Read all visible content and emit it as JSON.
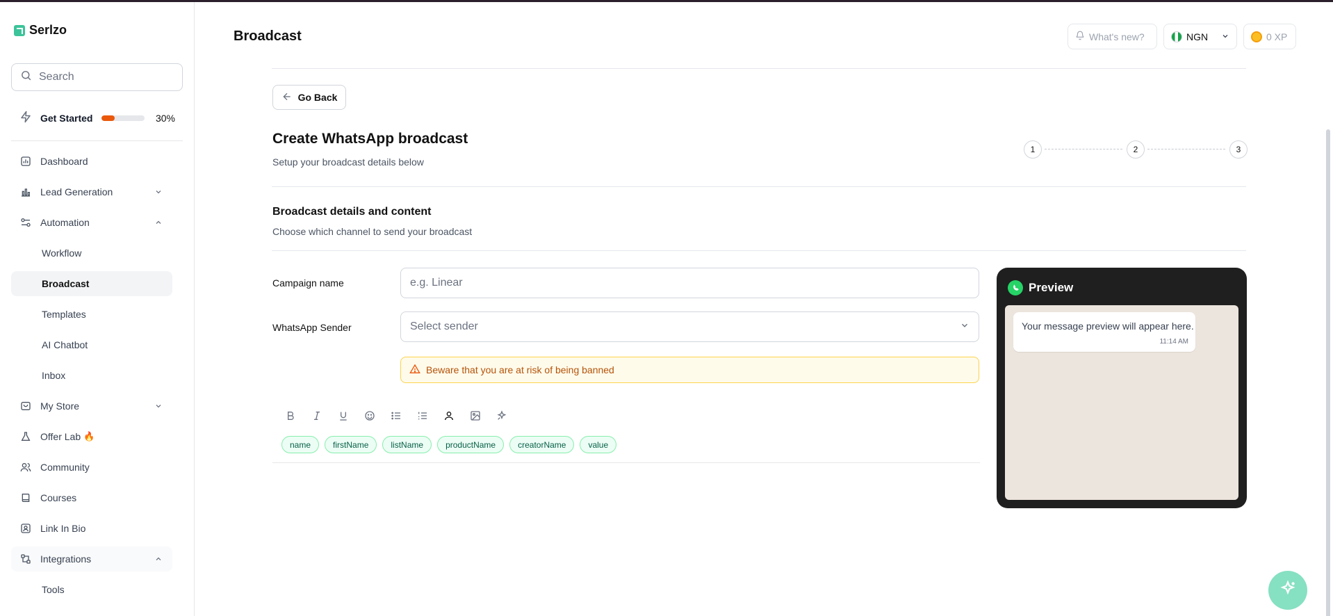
{
  "app": {
    "name": "Serlzo"
  },
  "sidebar": {
    "search_placeholder": "Search",
    "get_started": {
      "label": "Get Started",
      "progress_percent": 30,
      "progress_text": "30%"
    },
    "items": [
      {
        "label": "Dashboard",
        "icon": "chart-icon"
      },
      {
        "label": "Lead Generation",
        "icon": "chart-bar-icon",
        "expanded": false
      },
      {
        "label": "Automation",
        "icon": "automation-icon",
        "expanded": true
      },
      {
        "label": "Workflow",
        "sub": true
      },
      {
        "label": "Broadcast",
        "sub": true,
        "active": true
      },
      {
        "label": "Templates",
        "sub": true
      },
      {
        "label": "AI Chatbot",
        "sub": true
      },
      {
        "label": "Inbox",
        "sub": true
      },
      {
        "label": "My Store",
        "icon": "store-icon",
        "expanded": false
      },
      {
        "label": "Offer Lab",
        "icon": "flask-icon",
        "badge": "🔥"
      },
      {
        "label": "Community",
        "icon": "users-icon"
      },
      {
        "label": "Courses",
        "icon": "book-icon"
      },
      {
        "label": "Link In Bio",
        "icon": "profile-card-icon"
      },
      {
        "label": "Integrations",
        "icon": "integrations-icon",
        "expanded": true
      },
      {
        "label": "Tools",
        "sub": true
      }
    ]
  },
  "header": {
    "title": "Broadcast",
    "whats_new": "What's new?",
    "currency": "NGN",
    "xp": "0 XP"
  },
  "main": {
    "go_back": "Go Back",
    "title": "Create WhatsApp broadcast",
    "subtitle": "Setup your broadcast details below",
    "steps": [
      "1",
      "2",
      "3"
    ],
    "section_title": "Broadcast details and content",
    "section_subtitle": "Choose which channel to send your broadcast",
    "campaign_label": "Campaign name",
    "campaign_placeholder": "e.g. Linear",
    "sender_label": "WhatsApp Sender",
    "sender_placeholder": "Select sender",
    "warning": "Beware that you are at risk of being banned",
    "toolbar": [
      "bold-icon",
      "italic-icon",
      "underline-icon",
      "emoji-icon",
      "bullet-list-icon",
      "numbered-list-icon",
      "person-icon",
      "image-icon",
      "ai-sparkle-icon"
    ],
    "tags": [
      "name",
      "firstName",
      "listName",
      "productName",
      "creatorName",
      "value"
    ]
  },
  "preview": {
    "title": "Preview",
    "message": "Your message preview will appear here.",
    "time": "11:14 AM"
  },
  "colors": {
    "accent": "#3cc39a",
    "progress": "#ea580c",
    "warning_text": "#b45309",
    "preview_bg": "#1f1f1f",
    "chat_bg": "#ece5dd"
  }
}
